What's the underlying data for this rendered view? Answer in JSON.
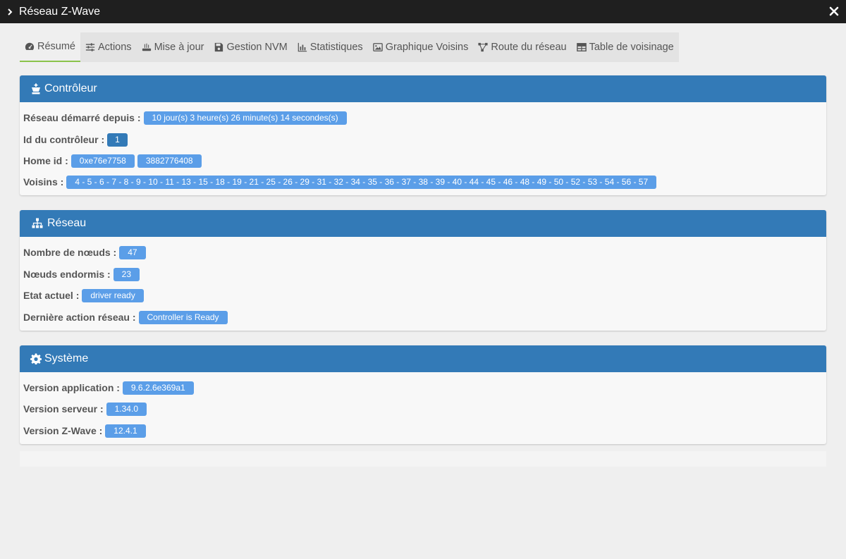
{
  "window": {
    "title": "Réseau Z-Wave"
  },
  "tabs": [
    {
      "label": "Résumé",
      "icon": "dashboard-icon"
    },
    {
      "label": "Actions",
      "icon": "sliders-icon"
    },
    {
      "label": "Mise à jour",
      "icon": "router-icon"
    },
    {
      "label": "Gestion NVM",
      "icon": "save-icon"
    },
    {
      "label": "Statistiques",
      "icon": "bar-chart-icon"
    },
    {
      "label": "Graphique Voisins",
      "icon": "image-icon"
    },
    {
      "label": "Route du réseau",
      "icon": "network-route-icon"
    },
    {
      "label": "Table de voisinage",
      "icon": "table-icon"
    }
  ],
  "controller": {
    "title": "Contrôleur",
    "started_label": "Réseau démarré depuis :",
    "started_value": "10 jour(s) 3 heure(s) 26 minute(s) 14 secondes(s)",
    "id_label": "Id du contrôleur :",
    "id_value": "1",
    "home_label": "Home id :",
    "home_hex": "0xe76e7758",
    "home_dec": "3882776408",
    "neighbors_label": "Voisins :",
    "neighbors_value": "4 - 5 - 6 - 7 - 8 - 9 - 10 - 11 - 13 - 15 - 18 - 19 - 21 - 25 - 26 - 29 - 31 - 32 - 34 - 35 - 36 - 37 - 38 - 39 - 40 - 44 - 45 - 46 - 48 - 49 - 50 - 52 - 53 - 54 - 56 - 57"
  },
  "network": {
    "title": "Réseau",
    "nodes_label": "Nombre de nœuds :",
    "nodes_value": "47",
    "sleeping_label": "Nœuds endormis :",
    "sleeping_value": "23",
    "state_label": "Etat actuel :",
    "state_value": "driver ready",
    "last_action_label": "Dernière action réseau :",
    "last_action_value": "Controller is Ready"
  },
  "system": {
    "title": "Système",
    "app_label": "Version application :",
    "app_value": "9.6.2.6e369a1",
    "server_label": "Version serveur :",
    "server_value": "1.34.0",
    "zwave_label": "Version Z-Wave :",
    "zwave_value": "12.4.1"
  },
  "colors": {
    "header": "#337ab7",
    "badge": "#5b9ee8",
    "active_tab_underline": "#8bc34a",
    "titlebar": "#1f1f1f"
  }
}
